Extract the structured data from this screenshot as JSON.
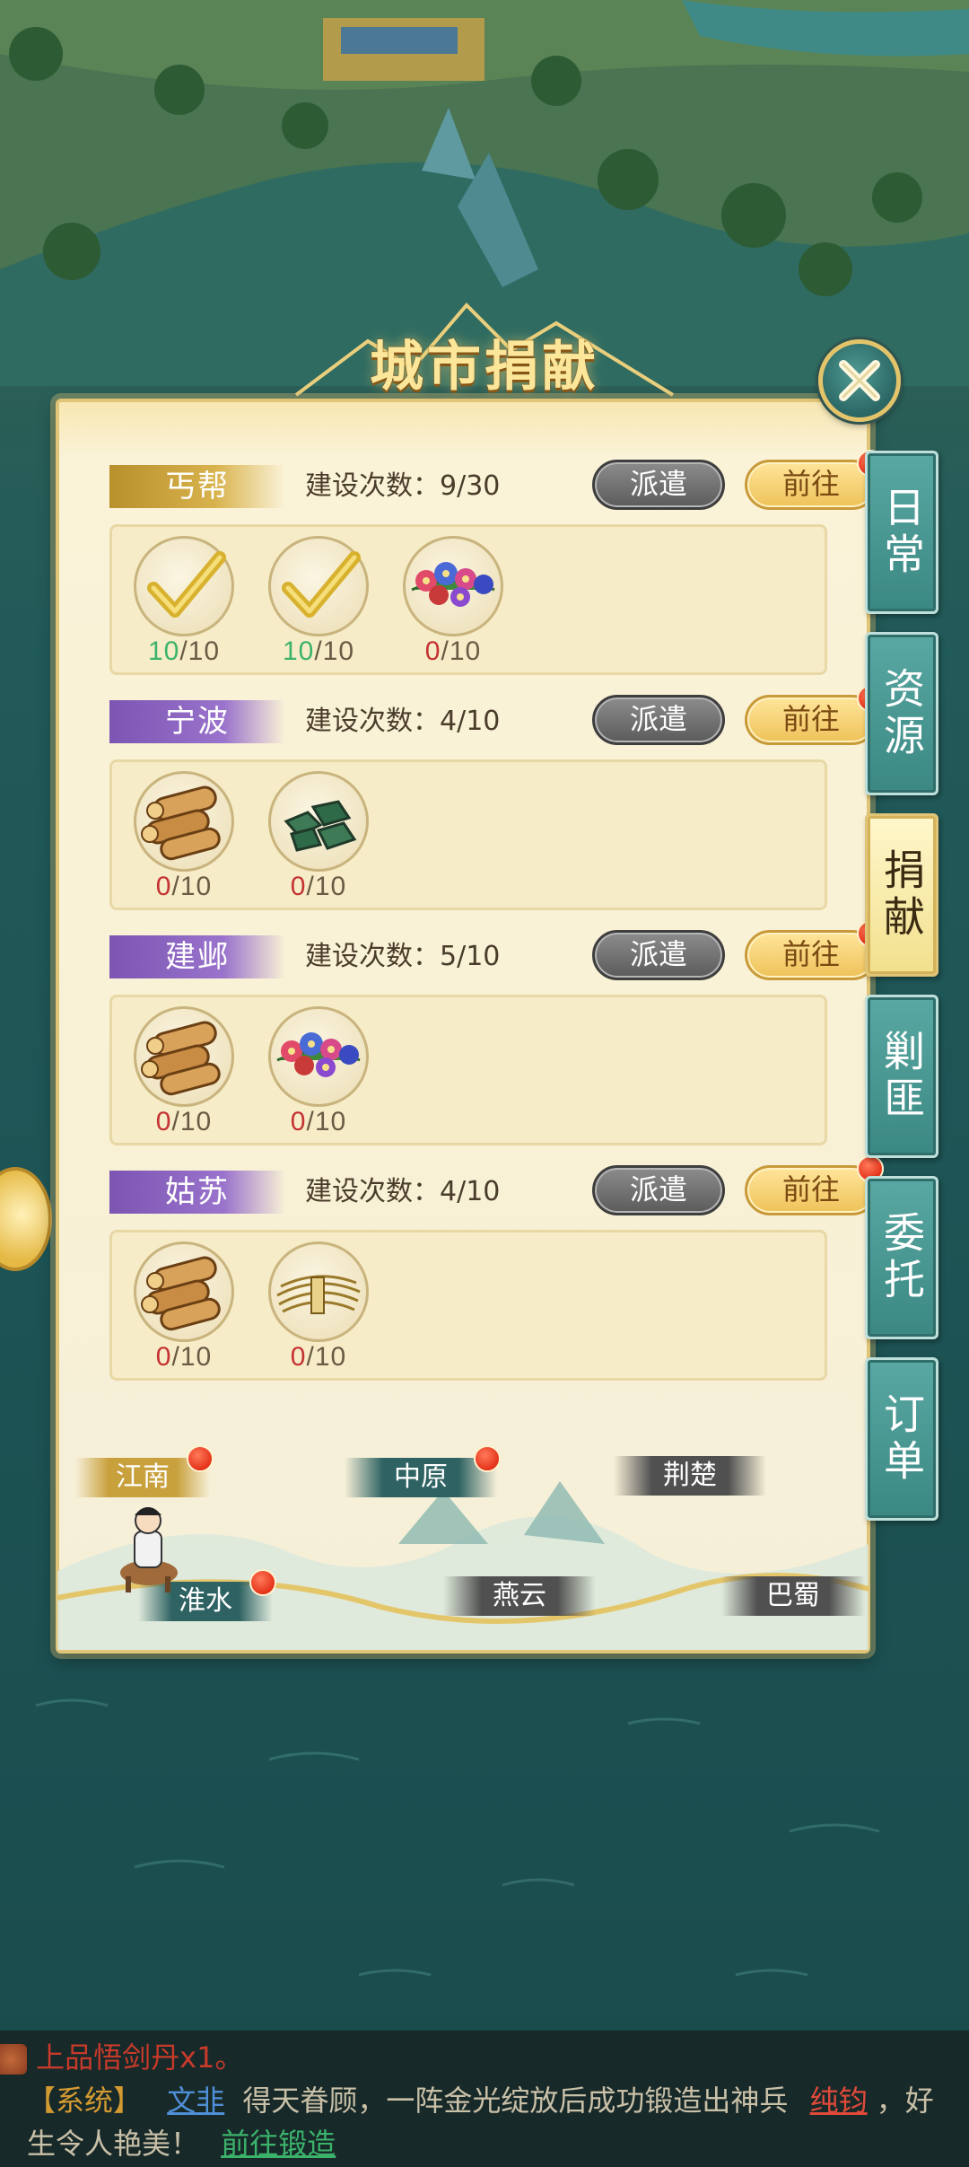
{
  "panel": {
    "title": "城市捐献"
  },
  "tabs": [
    {
      "label": "日常",
      "active": false
    },
    {
      "label": "资源",
      "active": false
    },
    {
      "label": "捐献",
      "active": true
    },
    {
      "label": "剿匪",
      "active": false
    },
    {
      "label": "委托",
      "active": false
    },
    {
      "label": "订单",
      "active": false
    }
  ],
  "cities": [
    {
      "name": "丐帮",
      "tag_color": "gold",
      "build_label": "建设次数：9/30",
      "dispatch_label": "派遣",
      "goto_label": "前往",
      "items": [
        {
          "icon": "checkmark-icon",
          "have": "10",
          "need": "/10",
          "done": true
        },
        {
          "icon": "checkmark-icon",
          "have": "10",
          "need": "/10",
          "done": true
        },
        {
          "icon": "flowers-icon",
          "have": "0",
          "need": "/10",
          "done": false
        }
      ]
    },
    {
      "name": "宁波",
      "tag_color": "purple",
      "build_label": "建设次数：4/10",
      "dispatch_label": "派遣",
      "goto_label": "前往",
      "items": [
        {
          "icon": "wood-logs-icon",
          "have": "0",
          "need": "/10",
          "done": false
        },
        {
          "icon": "jade-stones-icon",
          "have": "0",
          "need": "/10",
          "done": false
        }
      ]
    },
    {
      "name": "建邺",
      "tag_color": "purple",
      "build_label": "建设次数：5/10",
      "dispatch_label": "派遣",
      "goto_label": "前往",
      "items": [
        {
          "icon": "wood-logs-icon",
          "have": "0",
          "need": "/10",
          "done": false
        },
        {
          "icon": "flowers-icon",
          "have": "0",
          "need": "/10",
          "done": false
        }
      ]
    },
    {
      "name": "姑苏",
      "tag_color": "purple",
      "build_label": "建设次数：4/10",
      "dispatch_label": "派遣",
      "goto_label": "前往",
      "items": [
        {
          "icon": "wood-logs-icon",
          "have": "0",
          "need": "/10",
          "done": false
        },
        {
          "icon": "wheat-bundle-icon",
          "have": "0",
          "need": "/10",
          "done": false
        }
      ]
    }
  ],
  "regions": {
    "jiangnan": "江南",
    "zhongyuan": "中原",
    "jingchu": "荆楚",
    "huaishui": "淮水",
    "yanyun": "燕云",
    "bashu": "巴蜀"
  },
  "chat": {
    "line1": "上品悟剑丹x1。",
    "system_tag": "【系统】",
    "player": "文非",
    "text_a": "得天眷顾，一阵金光绽放后成功锻造出神兵",
    "weapon": "纯钧",
    "text_b": "，好",
    "text_c": "生令人艳美！",
    "link": "前往锻造"
  },
  "colors": {
    "accent_gold": "#e0c477",
    "notify_red": "#e4331a",
    "done_green": "#3bb36b"
  }
}
